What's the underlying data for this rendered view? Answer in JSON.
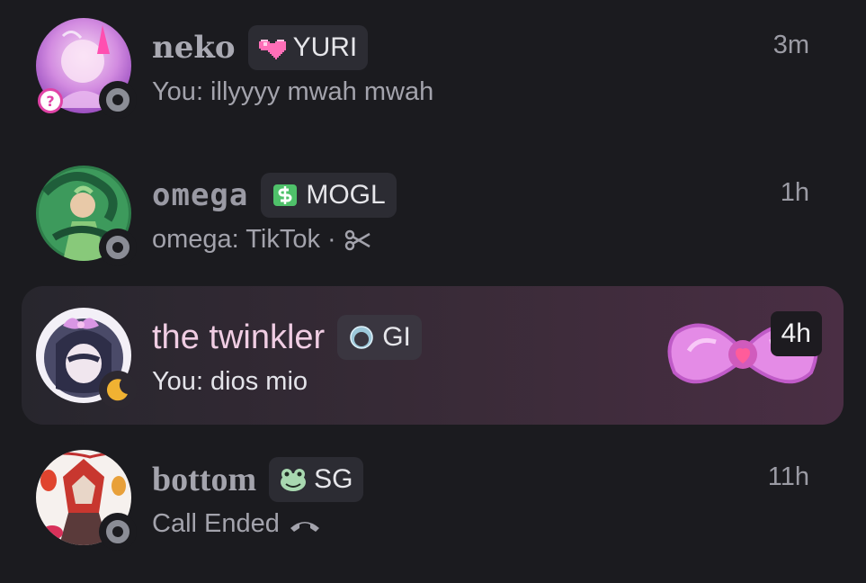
{
  "conversations": [
    {
      "name": "neko",
      "tag": {
        "icon": "pink-pixel-heart-icon",
        "label": "YURI"
      },
      "preview": "You: illyyyy mwah mwah",
      "time": "3m",
      "status": "offline",
      "avatar_badge": "?"
    },
    {
      "name": "omega",
      "tag": {
        "icon": "green-dollar-icon",
        "label": "MOGL"
      },
      "preview": "omega: TikTok",
      "preview_separator": "·",
      "preview_icon": "scissors-icon",
      "time": "1h",
      "status": "offline"
    },
    {
      "name": "the twinkler",
      "tag": {
        "icon": "crescent-ring-icon",
        "label": "GI"
      },
      "preview": "You: dios mio",
      "time": "4h",
      "status": "idle",
      "selected": true,
      "decoration": "pink-bow-icon"
    },
    {
      "name": "bottom",
      "tag": {
        "icon": "frog-icon",
        "label": "SG"
      },
      "preview": "Call Ended",
      "preview_icon": "hang-up-icon",
      "time": "11h",
      "status": "offline"
    }
  ],
  "colors": {
    "background": "#1b1b1f",
    "selected_row_gradient_end": "#4a2e44",
    "offline_status": "#8b8d96",
    "idle_status": "#f0b232",
    "highlight_name": "#f0cde3"
  }
}
